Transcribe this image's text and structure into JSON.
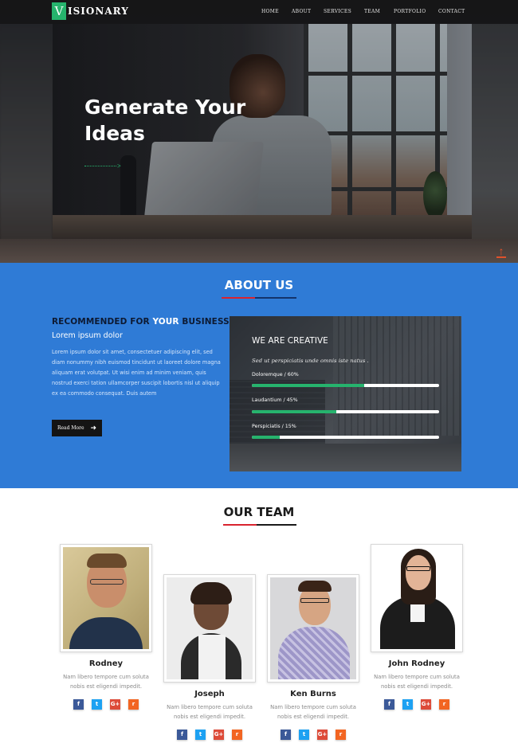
{
  "nav": {
    "logo_letter": "V",
    "logo_text": "ISIONARY",
    "links": [
      "HOME",
      "ABOUT",
      "SERVICES",
      "TEAM",
      "PORTFOLIO",
      "CONTACT"
    ]
  },
  "hero": {
    "title_line1": "Generate Your",
    "title_line2": "Ideas",
    "scroll_icon": "arrow-up-icon"
  },
  "about": {
    "title": "ABOUT US",
    "headline_pre": "RECOMMENDED FOR ",
    "headline_highlight": "YOUR",
    "headline_post": " BUSINESS",
    "subtitle": "Lorem ipsum dolor",
    "body": "Lorem ipsum dolor sit amet, consectetuer adipiscing elit, sed diam nonummy nibh euismod tincidunt ut laoreet dolore magna aliquam erat volutpat. Ut wisi enim ad minim veniam, quis nostrud exerci tation ullamcorper suscipit lobortis nisl ut aliquip ex ea commodo consequat. Duis autem",
    "read_more": "Read More",
    "creative": {
      "title": "WE ARE CREATIVE",
      "subtitle": "Sed ut perspiciatis unde omnis iste natus .",
      "skills": [
        {
          "label": "Doloremque / 60%",
          "percent": 60
        },
        {
          "label": "Laudantium / 45%",
          "percent": 45
        },
        {
          "label": "Perspiciatis / 15%",
          "percent": 15
        }
      ]
    }
  },
  "team": {
    "title": "OUR TEAM",
    "members": [
      {
        "name": "Rodney",
        "desc_line1": "Nam libero tempore cum soluta",
        "desc_line2": "nobis est eligendi impedit."
      },
      {
        "name": "Joseph",
        "desc_line1": "Nam libero tempore cum soluta",
        "desc_line2": "nobis est eligendi impedit."
      },
      {
        "name": "Ken Burns",
        "desc_line1": "Nam libero tempore cum soluta",
        "desc_line2": "nobis est eligendi impedit."
      },
      {
        "name": "John Rodney",
        "desc_line1": "Nam libero tempore cum soluta",
        "desc_line2": "nobis est eligendi impedit."
      }
    ],
    "social": {
      "facebook": "f",
      "twitter": "t",
      "googleplus": "G+",
      "rss": "r"
    }
  },
  "colors": {
    "accent_green": "#26b36d",
    "about_blue": "#2f7bd6",
    "underline_red": "#d9232e",
    "facebook": "#3b5998",
    "twitter": "#1da1f2",
    "googleplus": "#dd4b39",
    "rss": "#f26522"
  }
}
